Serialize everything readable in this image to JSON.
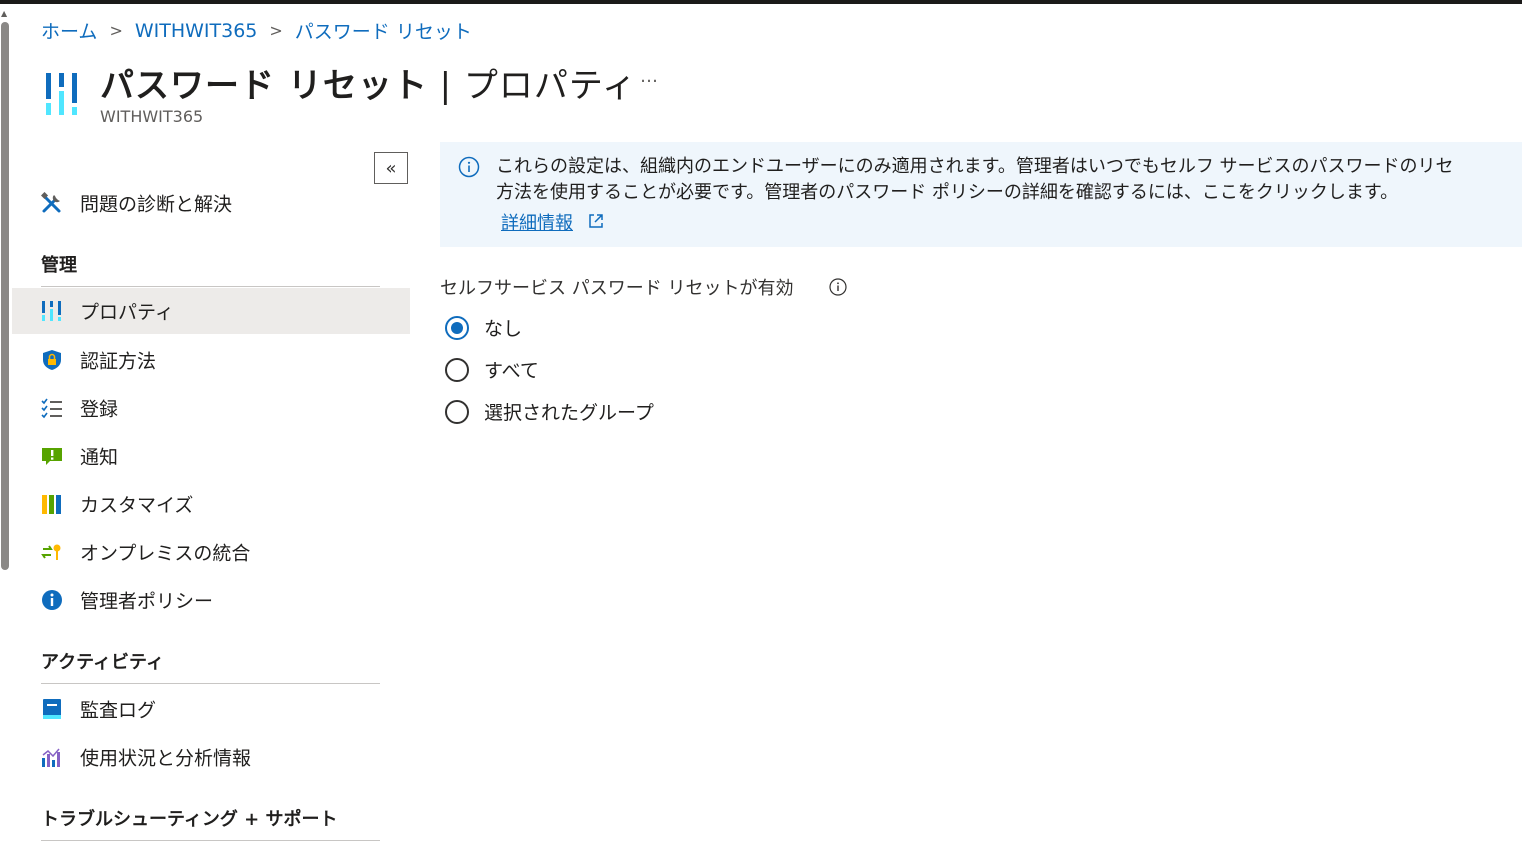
{
  "breadcrumb": {
    "home": "ホーム",
    "tenant": "WITHWIT365",
    "current": "パスワード リセット"
  },
  "header": {
    "title_main": "パスワード リセット",
    "title_sep": " | ",
    "title_page": "プロパティ",
    "more": "…",
    "subtitle": "WITHWIT365"
  },
  "sidebar": {
    "collapse_label": "«",
    "diagnose": {
      "label": "問題の診断と解決",
      "icon": "wrench-screwdriver-icon"
    },
    "sections": {
      "manage": "管理",
      "activity": "アクティビティ",
      "troubleshoot": "トラブルシューティング + サポート"
    },
    "manage_items": [
      {
        "label": "プロパティ",
        "icon": "properties-bars-icon",
        "selected": true
      },
      {
        "label": "認証方法",
        "icon": "shield-lock-icon"
      },
      {
        "label": "登録",
        "icon": "checklist-icon"
      },
      {
        "label": "通知",
        "icon": "notification-icon"
      },
      {
        "label": "カスタマイズ",
        "icon": "customize-bars-icon"
      },
      {
        "label": "オンプレミスの統合",
        "icon": "sync-key-icon"
      },
      {
        "label": "管理者ポリシー",
        "icon": "info-circle-icon"
      }
    ],
    "activity_items": [
      {
        "label": "監査ログ",
        "icon": "audit-log-icon"
      },
      {
        "label": "使用状況と分析情報",
        "icon": "analytics-icon"
      }
    ]
  },
  "info_bar": {
    "line1": "これらの設定は、組織内のエンドユーザーにのみ適用されます。管理者はいつでもセルフ サービスのパスワードのリセ",
    "line2": "方法を使用することが必要です。管理者のパスワード ポリシーの詳細を確認するには、ここをクリックします。",
    "link": "詳細情報"
  },
  "sspr": {
    "label": "セルフサービス パスワード リセットが有効",
    "options": [
      "なし",
      "すべて",
      "選択されたグループ"
    ],
    "selected": "なし"
  },
  "colors": {
    "accent": "#0f6cbd",
    "info_bg": "#eff6fc",
    "selected_bg": "#edebe9"
  }
}
